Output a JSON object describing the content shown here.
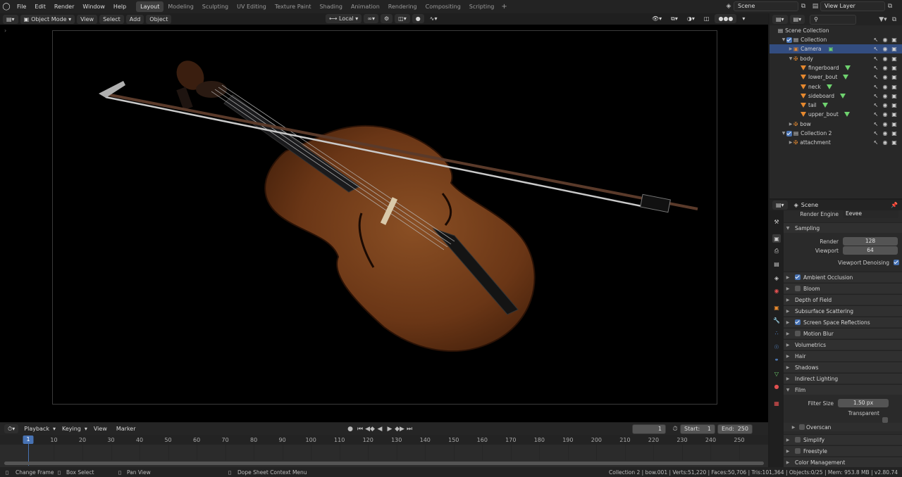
{
  "app": {
    "logo": "blender-logo"
  },
  "menu": [
    "File",
    "Edit",
    "Render",
    "Window",
    "Help"
  ],
  "workspaces": {
    "tabs": [
      "Layout",
      "Modeling",
      "Sculpting",
      "UV Editing",
      "Texture Paint",
      "Shading",
      "Animation",
      "Rendering",
      "Compositing",
      "Scripting"
    ],
    "active": "Layout",
    "add": "+"
  },
  "scene_field": "Scene",
  "view_layer_field": "View Layer",
  "viewport_header": {
    "mode": "Object Mode",
    "menus": [
      "View",
      "Select",
      "Add",
      "Object"
    ],
    "orientation": "Local"
  },
  "timeline": {
    "menus": [
      "Playback",
      "Keying",
      "View",
      "Marker"
    ],
    "current_frame": "1",
    "start_label": "Start:",
    "start": "1",
    "end_label": "End:",
    "end": "250",
    "ruler": [
      "1",
      "10",
      "20",
      "30",
      "40",
      "50",
      "60",
      "70",
      "80",
      "90",
      "100",
      "110",
      "120",
      "130",
      "140",
      "150",
      "160",
      "170",
      "180",
      "190",
      "200",
      "210",
      "220",
      "230",
      "240",
      "250"
    ]
  },
  "status": {
    "change_frame": "Change Frame",
    "box_select": "Box Select",
    "pan_view": "Pan View",
    "context_menu": "Dope Sheet Context Menu",
    "stats": "Collection 2 | bow.001 | Verts:51,220 | Faces:50,706 | Tris:101,364 | Objects:0/25 | Mem: 953.8 MB | v2.80.74"
  },
  "outliner": {
    "root": "Scene Collection",
    "rows": [
      {
        "name": "Collection",
        "indent": 1,
        "type": "collection",
        "expanded": true,
        "checked": true
      },
      {
        "name": "Camera",
        "indent": 2,
        "type": "camera",
        "selected": true
      },
      {
        "name": "body",
        "indent": 2,
        "type": "empty",
        "expanded": true
      },
      {
        "name": "fingerboard",
        "indent": 3,
        "type": "mesh"
      },
      {
        "name": "lower_bout",
        "indent": 3,
        "type": "mesh"
      },
      {
        "name": "neck",
        "indent": 3,
        "type": "mesh"
      },
      {
        "name": "sideboard",
        "indent": 3,
        "type": "mesh"
      },
      {
        "name": "tail",
        "indent": 3,
        "type": "mesh"
      },
      {
        "name": "upper_bout",
        "indent": 3,
        "type": "mesh"
      },
      {
        "name": "bow",
        "indent": 2,
        "type": "empty"
      },
      {
        "name": "Collection 2",
        "indent": 1,
        "type": "collection",
        "expanded": true,
        "checked": true
      },
      {
        "name": "attachment",
        "indent": 2,
        "type": "empty"
      }
    ]
  },
  "properties": {
    "context": "Scene",
    "render_engine_label": "Render Engine",
    "render_engine": "Eevee",
    "sampling": {
      "title": "Sampling",
      "render_label": "Render",
      "render": "128",
      "viewport_label": "Viewport",
      "viewport": "64",
      "denoise_label": "Viewport Denoising"
    },
    "panels": [
      {
        "label": "Ambient Occlusion",
        "check": "on"
      },
      {
        "label": "Bloom",
        "check": "off"
      },
      {
        "label": "Depth of Field",
        "check": "none"
      },
      {
        "label": "Subsurface Scattering",
        "check": "none"
      },
      {
        "label": "Screen Space Reflections",
        "check": "on"
      },
      {
        "label": "Motion Blur",
        "check": "off"
      },
      {
        "label": "Volumetrics",
        "check": "none"
      },
      {
        "label": "Hair",
        "check": "none"
      },
      {
        "label": "Shadows",
        "check": "none"
      },
      {
        "label": "Indirect Lighting",
        "check": "none"
      }
    ],
    "film": {
      "title": "Film",
      "filter_label": "Filter Size",
      "filter": "1.50 px",
      "transparent_label": "Transparent",
      "overscan_label": "Overscan"
    },
    "tail_panels": [
      {
        "label": "Simplify",
        "check": "off"
      },
      {
        "label": "Freestyle",
        "check": "off"
      },
      {
        "label": "Color Management",
        "check": "none"
      }
    ]
  }
}
